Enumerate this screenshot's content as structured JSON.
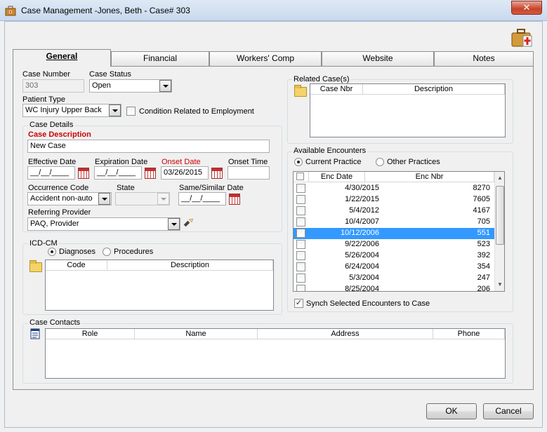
{
  "window": {
    "title": "Case Management -Jones, Beth  - Case#  303",
    "close_label": "✕"
  },
  "tabs": [
    {
      "label": "General"
    },
    {
      "label": "Financial"
    },
    {
      "label": "Workers' Comp"
    },
    {
      "label": "Website"
    },
    {
      "label": "Notes"
    }
  ],
  "case": {
    "number_label": "Case Number",
    "number_value": "303",
    "status_label": "Case Status",
    "status_value": "Open",
    "patient_type_label": "Patient Type",
    "patient_type_value": "WC Injury Upper Back",
    "condition_label": "Condition Related to Employment"
  },
  "details": {
    "group_label": "Case Details",
    "description_label": "Case Description",
    "description_value": "New Case",
    "effective_label": "Effective Date",
    "effective_value": "__/__/____",
    "expiration_label": "Expiration Date",
    "expiration_value": "__/__/____",
    "onset_label": "Onset Date",
    "onset_value": "03/26/2015",
    "onset_time_label": "Onset Time",
    "onset_time_value": "",
    "occurrence_label": "Occurrence Code",
    "occurrence_value": "Accident non-auto",
    "state_label": "State",
    "state_value": "",
    "same_similar_label": "Same/Similar Date",
    "same_similar_value": "__/__/____",
    "referring_label": "Referring Provider",
    "referring_value": "PAQ, Provider"
  },
  "icd": {
    "group_label": "ICD-CM",
    "diagnoses_label": "Diagnoses",
    "procedures_label": "Procedures",
    "col_code": "Code",
    "col_description": "Description"
  },
  "related": {
    "group_label": "Related Case(s)",
    "col_case_nbr": "Case Nbr",
    "col_description": "Description"
  },
  "encounters": {
    "group_label": "Available Encounters",
    "current_label": "Current Practice",
    "other_label": "Other Practices",
    "col_date": "Enc Date",
    "col_nbr": "Enc Nbr",
    "rows": [
      {
        "date": "4/30/2015",
        "nbr": "8270"
      },
      {
        "date": "1/22/2015",
        "nbr": "7605"
      },
      {
        "date": "5/4/2012",
        "nbr": "4167"
      },
      {
        "date": "10/4/2007",
        "nbr": "705"
      },
      {
        "date": "10/12/2006",
        "nbr": "551"
      },
      {
        "date": "9/22/2006",
        "nbr": "523"
      },
      {
        "date": "5/26/2004",
        "nbr": "392"
      },
      {
        "date": "6/24/2004",
        "nbr": "354"
      },
      {
        "date": "5/3/2004",
        "nbr": "247"
      },
      {
        "date": "8/25/2004",
        "nbr": "206"
      }
    ],
    "synch_label": "Synch Selected Encounters to Case"
  },
  "contacts": {
    "group_label": "Case Contacts",
    "col_role": "Role",
    "col_name": "Name",
    "col_address": "Address",
    "col_phone": "Phone"
  },
  "buttons": {
    "ok": "OK",
    "cancel": "Cancel"
  },
  "icons": {
    "title": "briefcase-icon",
    "case_toolbar": "medical-briefcase-icon",
    "folder": "open-folder-icon",
    "flashlight": "flashlight-icon",
    "contacts": "notepad-icon",
    "calendar": "calendar-icon"
  }
}
